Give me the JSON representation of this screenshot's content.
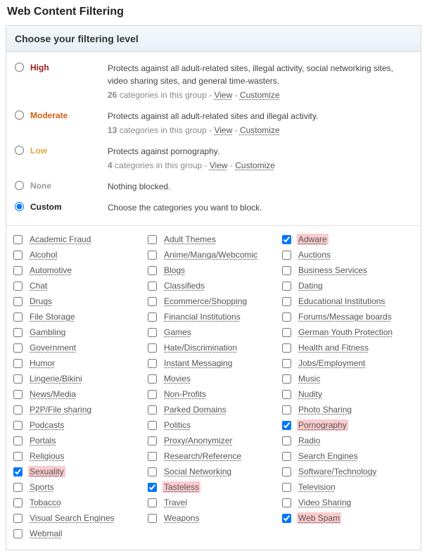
{
  "page_title": "Web Content Filtering",
  "panel_title": "Choose your filtering level",
  "levels": [
    {
      "id": "high",
      "label": "High",
      "class": "lv-high",
      "selected": false,
      "desc": "Protects against all adult-related sites, illegal activity, social networking sites, video sharing sites, and general time-wasters.",
      "count": "26",
      "count_text": " categories in this group - ",
      "view": "View",
      "sep": " - ",
      "customize": "Customize"
    },
    {
      "id": "moderate",
      "label": "Moderate",
      "class": "lv-moderate",
      "selected": false,
      "desc": "Protects against all adult-related sites and illegal activity.",
      "count": "13",
      "count_text": " categories in this group - ",
      "view": "View",
      "sep": " - ",
      "customize": "Customize"
    },
    {
      "id": "low",
      "label": "Low",
      "class": "lv-low",
      "selected": false,
      "desc": "Protects against pornography.",
      "count": "4",
      "count_text": " categories in this group - ",
      "view": "View",
      "sep": " - ",
      "customize": "Customize"
    },
    {
      "id": "none",
      "label": "None",
      "class": "lv-none",
      "selected": false,
      "desc": "Nothing blocked."
    },
    {
      "id": "custom",
      "label": "Custom",
      "class": "lv-custom",
      "selected": true,
      "desc": "Choose the categories you want to block."
    }
  ],
  "categories": {
    "col1": [
      {
        "label": "Academic Fraud",
        "checked": false,
        "hl": false
      },
      {
        "label": "Alcohol",
        "checked": false,
        "hl": false
      },
      {
        "label": "Automotive",
        "checked": false,
        "hl": false
      },
      {
        "label": "Chat",
        "checked": false,
        "hl": false
      },
      {
        "label": "Drugs",
        "checked": false,
        "hl": false
      },
      {
        "label": "File Storage",
        "checked": false,
        "hl": false
      },
      {
        "label": "Gambling",
        "checked": false,
        "hl": false
      },
      {
        "label": "Government",
        "checked": false,
        "hl": false
      },
      {
        "label": "Humor",
        "checked": false,
        "hl": false
      },
      {
        "label": "Lingerie/Bikini",
        "checked": false,
        "hl": false
      },
      {
        "label": "News/Media",
        "checked": false,
        "hl": false
      },
      {
        "label": "P2P/File sharing",
        "checked": false,
        "hl": false
      },
      {
        "label": "Podcasts",
        "checked": false,
        "hl": false
      },
      {
        "label": "Portals",
        "checked": false,
        "hl": false
      },
      {
        "label": "Religious",
        "checked": false,
        "hl": false
      },
      {
        "label": "Sexuality",
        "checked": true,
        "hl": true
      },
      {
        "label": "Sports",
        "checked": false,
        "hl": false
      },
      {
        "label": "Tobacco",
        "checked": false,
        "hl": false
      },
      {
        "label": "Visual Search Engines",
        "checked": false,
        "hl": false
      },
      {
        "label": "Webmail",
        "checked": false,
        "hl": false
      }
    ],
    "col2": [
      {
        "label": "Adult Themes",
        "checked": false,
        "hl": false
      },
      {
        "label": "Anime/Manga/Webcomic",
        "checked": false,
        "hl": false
      },
      {
        "label": "Blogs",
        "checked": false,
        "hl": false
      },
      {
        "label": "Classifieds",
        "checked": false,
        "hl": false
      },
      {
        "label": "Ecommerce/Shopping",
        "checked": false,
        "hl": false
      },
      {
        "label": "Financial Institutions",
        "checked": false,
        "hl": false
      },
      {
        "label": "Games",
        "checked": false,
        "hl": false
      },
      {
        "label": "Hate/Discrimination",
        "checked": false,
        "hl": false
      },
      {
        "label": "Instant Messaging",
        "checked": false,
        "hl": false
      },
      {
        "label": "Movies",
        "checked": false,
        "hl": false
      },
      {
        "label": "Non-Profits",
        "checked": false,
        "hl": false
      },
      {
        "label": "Parked Domains",
        "checked": false,
        "hl": false
      },
      {
        "label": "Politics",
        "checked": false,
        "hl": false
      },
      {
        "label": "Proxy/Anonymizer",
        "checked": false,
        "hl": false
      },
      {
        "label": "Research/Reference",
        "checked": false,
        "hl": false
      },
      {
        "label": "Social Networking",
        "checked": false,
        "hl": false
      },
      {
        "label": "Tasteless",
        "checked": true,
        "hl": true
      },
      {
        "label": "Travel",
        "checked": false,
        "hl": false
      },
      {
        "label": "Weapons",
        "checked": false,
        "hl": false
      }
    ],
    "col3": [
      {
        "label": "Adware",
        "checked": true,
        "hl": true
      },
      {
        "label": "Auctions",
        "checked": false,
        "hl": false
      },
      {
        "label": "Business Services",
        "checked": false,
        "hl": false
      },
      {
        "label": "Dating",
        "checked": false,
        "hl": false
      },
      {
        "label": "Educational Institutions",
        "checked": false,
        "hl": false
      },
      {
        "label": "Forums/Message boards",
        "checked": false,
        "hl": false
      },
      {
        "label": "German Youth Protection",
        "checked": false,
        "hl": false
      },
      {
        "label": "Health and Fitness",
        "checked": false,
        "hl": false
      },
      {
        "label": "Jobs/Employment",
        "checked": false,
        "hl": false
      },
      {
        "label": "Music",
        "checked": false,
        "hl": false
      },
      {
        "label": "Nudity",
        "checked": false,
        "hl": false
      },
      {
        "label": "Photo Sharing",
        "checked": false,
        "hl": false
      },
      {
        "label": "Pornography",
        "checked": true,
        "hl": true
      },
      {
        "label": "Radio",
        "checked": false,
        "hl": false
      },
      {
        "label": "Search Engines",
        "checked": false,
        "hl": false
      },
      {
        "label": "Software/Technology",
        "checked": false,
        "hl": false
      },
      {
        "label": "Television",
        "checked": false,
        "hl": false
      },
      {
        "label": "Video Sharing",
        "checked": false,
        "hl": false
      },
      {
        "label": "Web Spam",
        "checked": true,
        "hl": true
      }
    ]
  }
}
